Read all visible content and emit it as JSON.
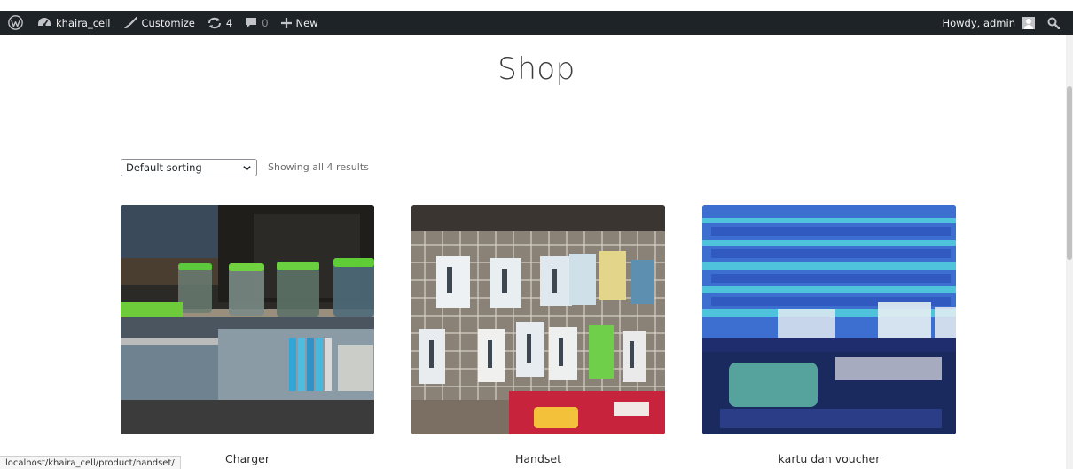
{
  "adminbar": {
    "site_name": "khaira_cell",
    "customize": "Customize",
    "updates_count": "4",
    "comments_count": "0",
    "new_label": "New",
    "howdy": "Howdy, admin"
  },
  "page": {
    "title": "Shop"
  },
  "toolbar": {
    "sort_selected": "Default sorting",
    "result_count": "Showing all 4 results"
  },
  "products": [
    {
      "title": "Charger",
      "image": "charger-photo"
    },
    {
      "title": "Handset",
      "image": "handset-photo"
    },
    {
      "title": "kartu dan voucher",
      "image": "voucher-photo"
    }
  ],
  "status_bar": {
    "url": "localhost/khaira_cell/product/handset/"
  },
  "colors": {
    "adminbar_bg": "#1d2327",
    "adminbar_text": "#f0f0f1"
  }
}
